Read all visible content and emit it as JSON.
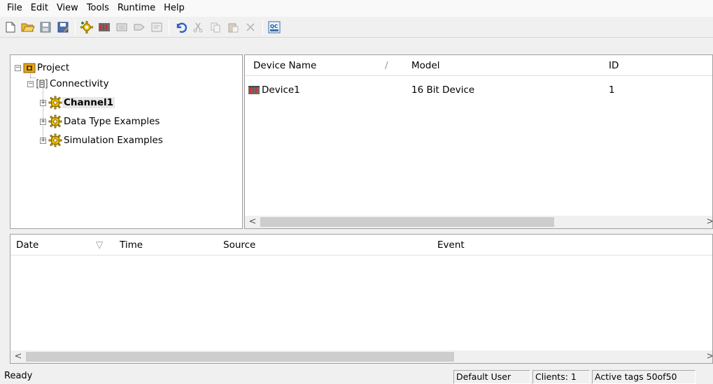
{
  "menu": [
    "File",
    "Edit",
    "View",
    "Tools",
    "Runtime",
    "Help"
  ],
  "toolbar_icons": [
    "new-icon",
    "open-icon",
    "save-icon",
    "save-as-icon",
    "new-channel-icon",
    "new-device-icon",
    "new-tag-group-icon",
    "new-tag-icon",
    "properties-icon",
    "undo-icon",
    "cut-icon",
    "copy-icon",
    "paste-icon",
    "delete-icon",
    "quick-client-icon"
  ],
  "tree": {
    "project": "Project",
    "connectivity": "Connectivity",
    "channels": [
      "Channel1",
      "Data Type Examples",
      "Simulation Examples"
    ]
  },
  "device_table": {
    "columns": [
      "Device Name",
      "Model",
      "ID"
    ],
    "rows": [
      {
        "name": "Device1",
        "model": "16 Bit Device",
        "id": "1"
      }
    ]
  },
  "event_table": {
    "columns": [
      "Date",
      "Time",
      "Source",
      "Event"
    ]
  },
  "status": {
    "text": "Ready",
    "user": "Default User",
    "clients": "Clients: 1",
    "active_tags": "Active tags 50of50"
  },
  "colors": {
    "gear": "#f4c400",
    "accent": "#000000"
  }
}
